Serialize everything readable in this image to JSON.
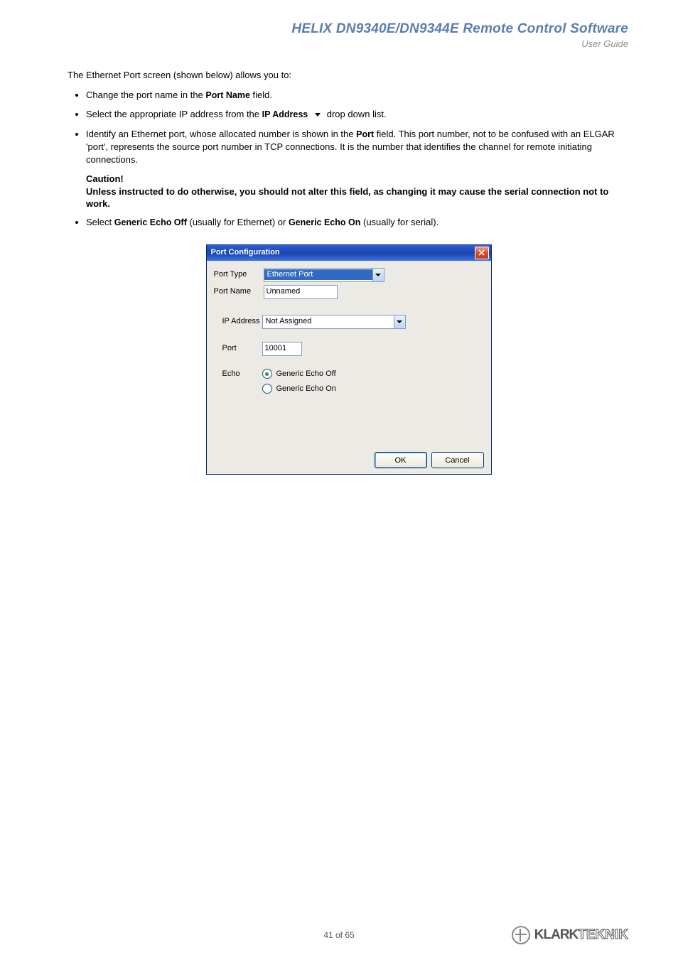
{
  "header": {
    "title": "HELIX DN9340E/DN9344E Remote Control Software",
    "subtitle": "User Guide"
  },
  "content": {
    "intro": "The Ethernet Port screen (shown below) allows you to:",
    "bullets": {
      "b1a": "Change the port name in the ",
      "b1_field": "Port Name",
      "b1b": " field.",
      "b2a": "Select the appropriate IP address from the ",
      "b2_field": "IP Address",
      "b2b": "drop down list.",
      "b3a": "Identify an Ethernet port, whose allocated number is shown in the ",
      "b3_field": "Port",
      "b3b": " field.  This port number, not to be confused with an ELGAR 'port', represents the source port number in TCP connections.  It is the number that identifies the channel for remote initiating connections.",
      "b4a": "Select ",
      "b4_opt1": "Generic Echo Off",
      "b4_mid": " (usually for Ethernet) or ",
      "b4_opt2": "Generic Echo On",
      "b4_end": " (usually for serial)."
    },
    "caution": {
      "heading": "Caution!",
      "text": "Unless instructed to do otherwise, you should not alter this field, as changing it may cause the serial connection not to work."
    }
  },
  "dialog": {
    "title": "Port Configuration",
    "labels": {
      "port_type": "Port Type",
      "port_name": "Port Name",
      "ip_address": "IP Address",
      "port": "Port",
      "echo": "Echo"
    },
    "values": {
      "port_type": "Ethernet Port",
      "port_name": "Unnamed",
      "ip_address": "Not Assigned",
      "port": "10001"
    },
    "echo_options": {
      "off": "Generic Echo Off",
      "on": "Generic Echo On"
    },
    "buttons": {
      "ok": "OK",
      "cancel": "Cancel"
    }
  },
  "footer": {
    "page": "41 of 65",
    "brand_a": "KLARK",
    "brand_b": "TEKNIK"
  }
}
